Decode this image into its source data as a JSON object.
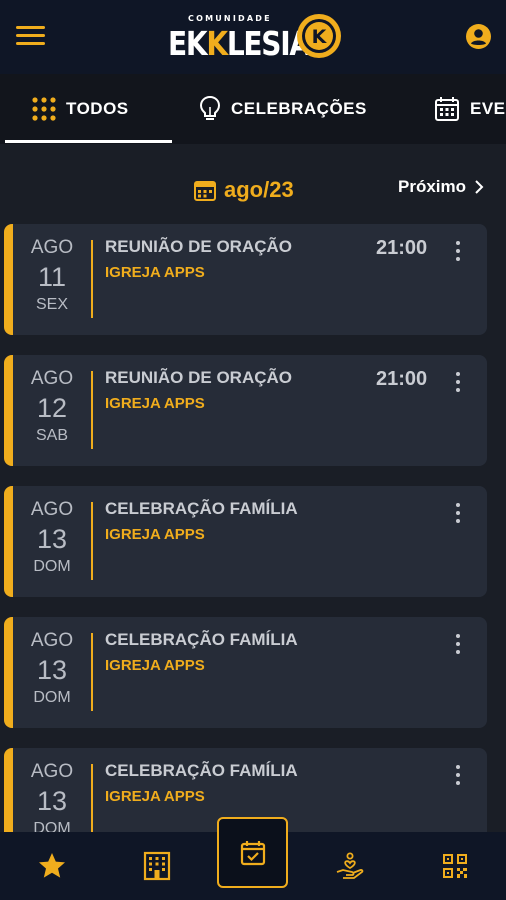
{
  "header": {
    "logo_small": "COMUNIDADE",
    "logo_part1": "EK",
    "logo_part2": "K",
    "logo_part3": "LESIA",
    "logo_badge_letter": "K",
    "menu_icon": "hamburger-menu-icon",
    "profile_icon": "account-circle-icon"
  },
  "tabs": [
    {
      "label": "TODOS",
      "icon": "grid-dots-icon",
      "active": true
    },
    {
      "label": "CELEBRAÇÕES",
      "icon": "lightbulb-icon"
    },
    {
      "label": "EVENTOS",
      "icon": "calendar-icon"
    }
  ],
  "calendar_nav": {
    "month": "ago/23",
    "next_label": "Próximo",
    "month_icon": "calendar-icon",
    "next_icon": "chevron-right-icon"
  },
  "events": [
    {
      "month": "AGO",
      "day": "11",
      "dow": "SEX",
      "title": "REUNIÃO DE ORAÇÃO",
      "org": "IGREJA APPS",
      "time": "21:00"
    },
    {
      "month": "AGO",
      "day": "12",
      "dow": "SAB",
      "title": "REUNIÃO DE ORAÇÃO",
      "org": "IGREJA APPS",
      "time": "21:00"
    },
    {
      "month": "AGO",
      "day": "13",
      "dow": "DOM",
      "title": "CELEBRAÇÃO FAMÍLIA",
      "org": "IGREJA APPS",
      "time": ""
    },
    {
      "month": "AGO",
      "day": "13",
      "dow": "DOM",
      "title": "CELEBRAÇÃO FAMÍLIA",
      "org": "IGREJA APPS",
      "time": ""
    },
    {
      "month": "AGO",
      "day": "13",
      "dow": "DOM",
      "title": "CELEBRAÇÃO FAMÍLIA",
      "org": "IGREJA APPS",
      "time": ""
    }
  ],
  "bottom_nav": [
    {
      "icon": "star-icon"
    },
    {
      "icon": "building-icon"
    },
    {
      "icon": "calendar-check-icon",
      "active": true
    },
    {
      "icon": "hand-heart-icon"
    },
    {
      "icon": "qr-code-icon"
    }
  ],
  "colors": {
    "accent": "#f0ad1d",
    "background": "#1a1e26",
    "card": "#262c38",
    "bar": "#0f1626"
  }
}
